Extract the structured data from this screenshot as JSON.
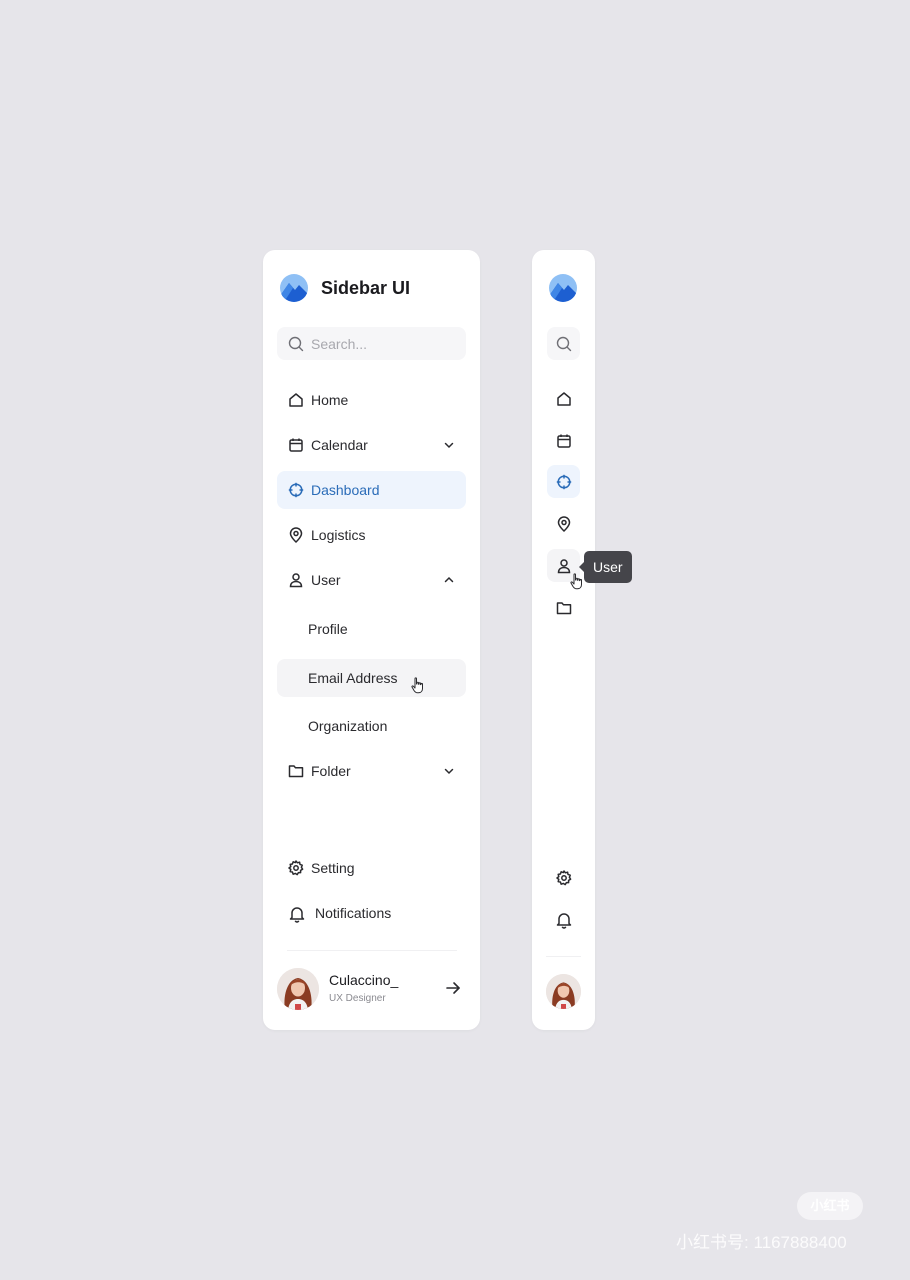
{
  "brand": {
    "name": "Sidebar UI",
    "logo_icon": "mountain-logo-icon",
    "logo_colors": [
      "#6aa8ee",
      "#1d5fd1"
    ]
  },
  "search": {
    "placeholder": "Search...",
    "icon": "search-icon"
  },
  "nav": {
    "home": {
      "label": "Home",
      "icon": "home-icon"
    },
    "calendar": {
      "label": "Calendar",
      "icon": "calendar-icon",
      "expanded": false
    },
    "dashboard": {
      "label": "Dashboard",
      "icon": "crosshair-icon",
      "active": true
    },
    "logistics": {
      "label": "Logistics",
      "icon": "location-pin-icon"
    },
    "user": {
      "label": "User",
      "icon": "user-icon",
      "expanded": true,
      "children": [
        "Profile",
        "Email Address",
        "Organization"
      ]
    },
    "folder": {
      "label": "Folder",
      "icon": "folder-icon",
      "expanded": false
    }
  },
  "bottom_nav": {
    "setting": {
      "label": "Setting",
      "icon": "gear-icon"
    },
    "notifications": {
      "label": "Notifications",
      "icon": "bell-icon"
    }
  },
  "user_card": {
    "name": "Culaccino_",
    "role": "UX Designer",
    "action_icon": "arrow-right-icon"
  },
  "tooltip": {
    "text": "User"
  },
  "watermark": {
    "badge": "小红书",
    "text": "小红书号: 1167888400"
  },
  "colors": {
    "background": "#e6e5ea",
    "panel": "#ffffff",
    "accent": "#2b6cb8",
    "active_bg": "#eef4fd",
    "tooltip_bg": "#45454a"
  }
}
